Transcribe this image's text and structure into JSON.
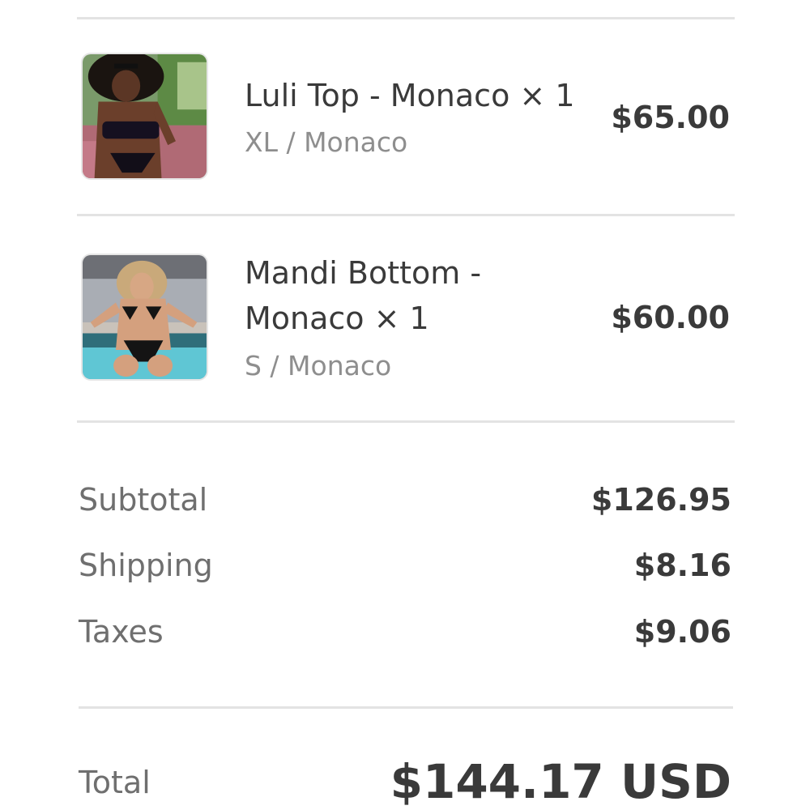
{
  "items": [
    {
      "name": "Luli Top - Monaco × 1",
      "variant": "XL / Monaco",
      "price": "$65.00"
    },
    {
      "name": "Mandi Bottom - Monaco × 1",
      "variant": "S / Monaco",
      "price": "$60.00"
    }
  ],
  "summary": {
    "subtotal_label": "Subtotal",
    "subtotal_value": "$126.95",
    "shipping_label": "Shipping",
    "shipping_value": "$8.16",
    "taxes_label": "Taxes",
    "taxes_value": "$9.06"
  },
  "total": {
    "label": "Total",
    "value": "$144.17 USD"
  }
}
